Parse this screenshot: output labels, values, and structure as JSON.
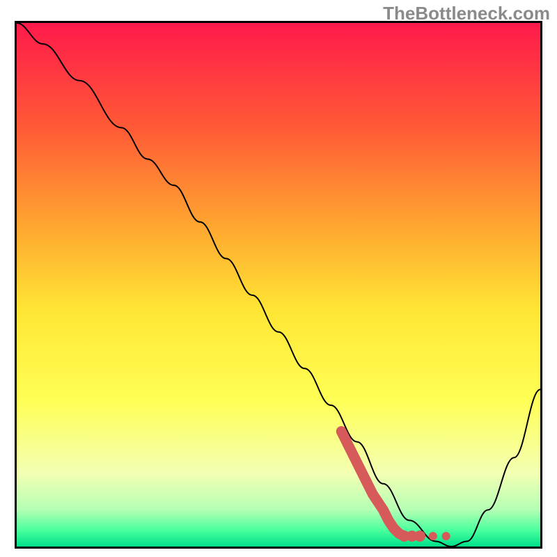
{
  "watermark": "TheBottleneck.com",
  "chart_data": {
    "type": "line",
    "title": "",
    "xlabel": "",
    "ylabel": "",
    "xlim": [
      0,
      100
    ],
    "ylim": [
      0,
      100
    ],
    "grid": false,
    "legend": false,
    "background_gradient": {
      "direction": "vertical",
      "stops": [
        {
          "pos": 0.0,
          "color": "#ff1a4b"
        },
        {
          "pos": 0.2,
          "color": "#ff5a36"
        },
        {
          "pos": 0.4,
          "color": "#ffab30"
        },
        {
          "pos": 0.55,
          "color": "#ffe634"
        },
        {
          "pos": 0.72,
          "color": "#ffff55"
        },
        {
          "pos": 0.86,
          "color": "#f3ffb3"
        },
        {
          "pos": 0.93,
          "color": "#b4ffb4"
        },
        {
          "pos": 0.97,
          "color": "#46ff9d"
        },
        {
          "pos": 1.0,
          "color": "#00e08a"
        }
      ]
    },
    "series": [
      {
        "name": "bottleneck-curve",
        "color": "#000000",
        "stroke_width": 2,
        "x": [
          0,
          5,
          12,
          20,
          25,
          30,
          35,
          40,
          45,
          50,
          55,
          60,
          65,
          70,
          75,
          80,
          83,
          86,
          90,
          95,
          100
        ],
        "y": [
          100,
          96,
          89,
          80,
          74,
          69,
          62,
          55,
          48,
          41,
          34,
          27,
          20,
          12,
          5,
          1,
          0,
          1,
          7,
          17,
          30
        ]
      }
    ],
    "highlight": {
      "name": "optimal-zone-marker",
      "color": "#d65a5a",
      "points": [
        {
          "x": 62,
          "y": 22
        },
        {
          "x": 64,
          "y": 18
        },
        {
          "x": 66,
          "y": 14
        },
        {
          "x": 68,
          "y": 10
        },
        {
          "x": 70,
          "y": 7
        },
        {
          "x": 71,
          "y": 5
        },
        {
          "x": 72,
          "y": 3.5
        },
        {
          "x": 73,
          "y": 2.5
        },
        {
          "x": 74,
          "y": 2
        },
        {
          "x": 75.5,
          "y": 2
        },
        {
          "x": 77,
          "y": 2
        },
        {
          "x": 79.5,
          "y": 2
        },
        {
          "x": 82,
          "y": 2
        }
      ]
    }
  }
}
